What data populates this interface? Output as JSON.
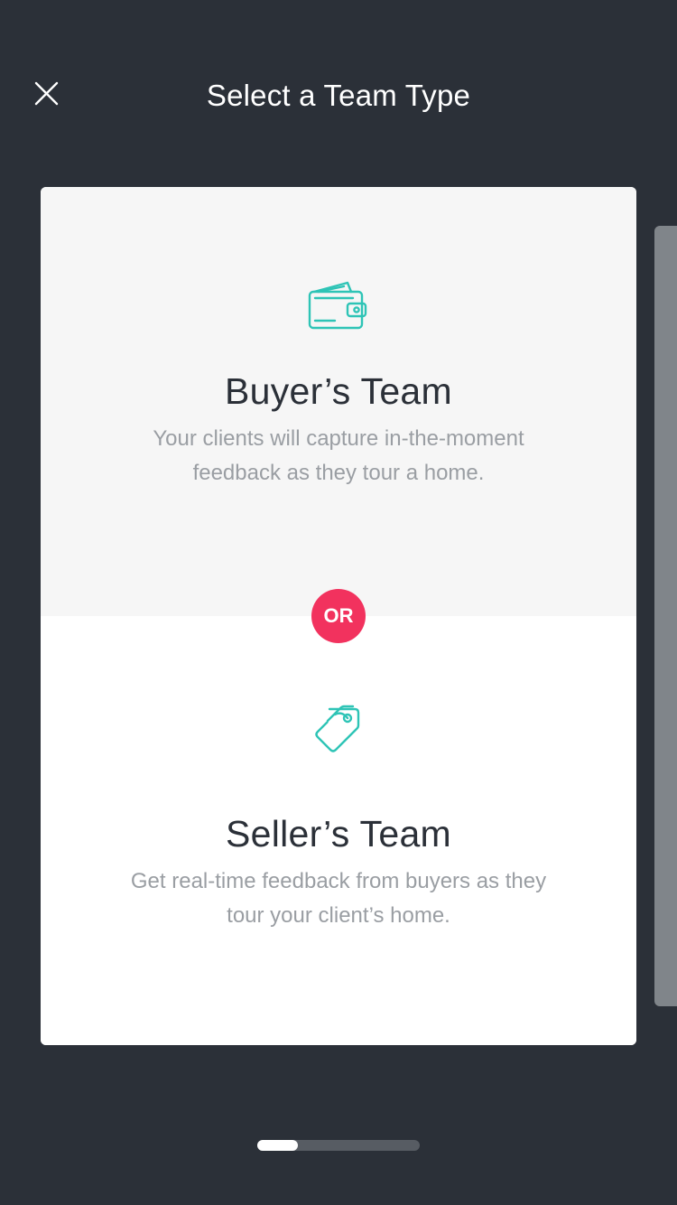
{
  "header": {
    "title": "Select a Team Type",
    "close_icon": "close-icon"
  },
  "options": [
    {
      "title": "Buyer’s Team",
      "description": "Your clients will capture in-the-moment feedback as they tour a home.",
      "icon": "wallet-icon"
    },
    {
      "title": "Seller’s Team",
      "description": "Get real-time feedback from buyers as they tour your client’s home.",
      "icon": "price-tag-icon"
    }
  ],
  "divider": {
    "label": "OR"
  },
  "pager": {
    "total_pages": 4,
    "current_page": 1
  },
  "colors": {
    "background": "#2b3038",
    "accent_teal": "#2ec4b6",
    "or_badge": "#f2325e",
    "card_top": "#f6f6f6",
    "card_bottom": "#ffffff"
  }
}
